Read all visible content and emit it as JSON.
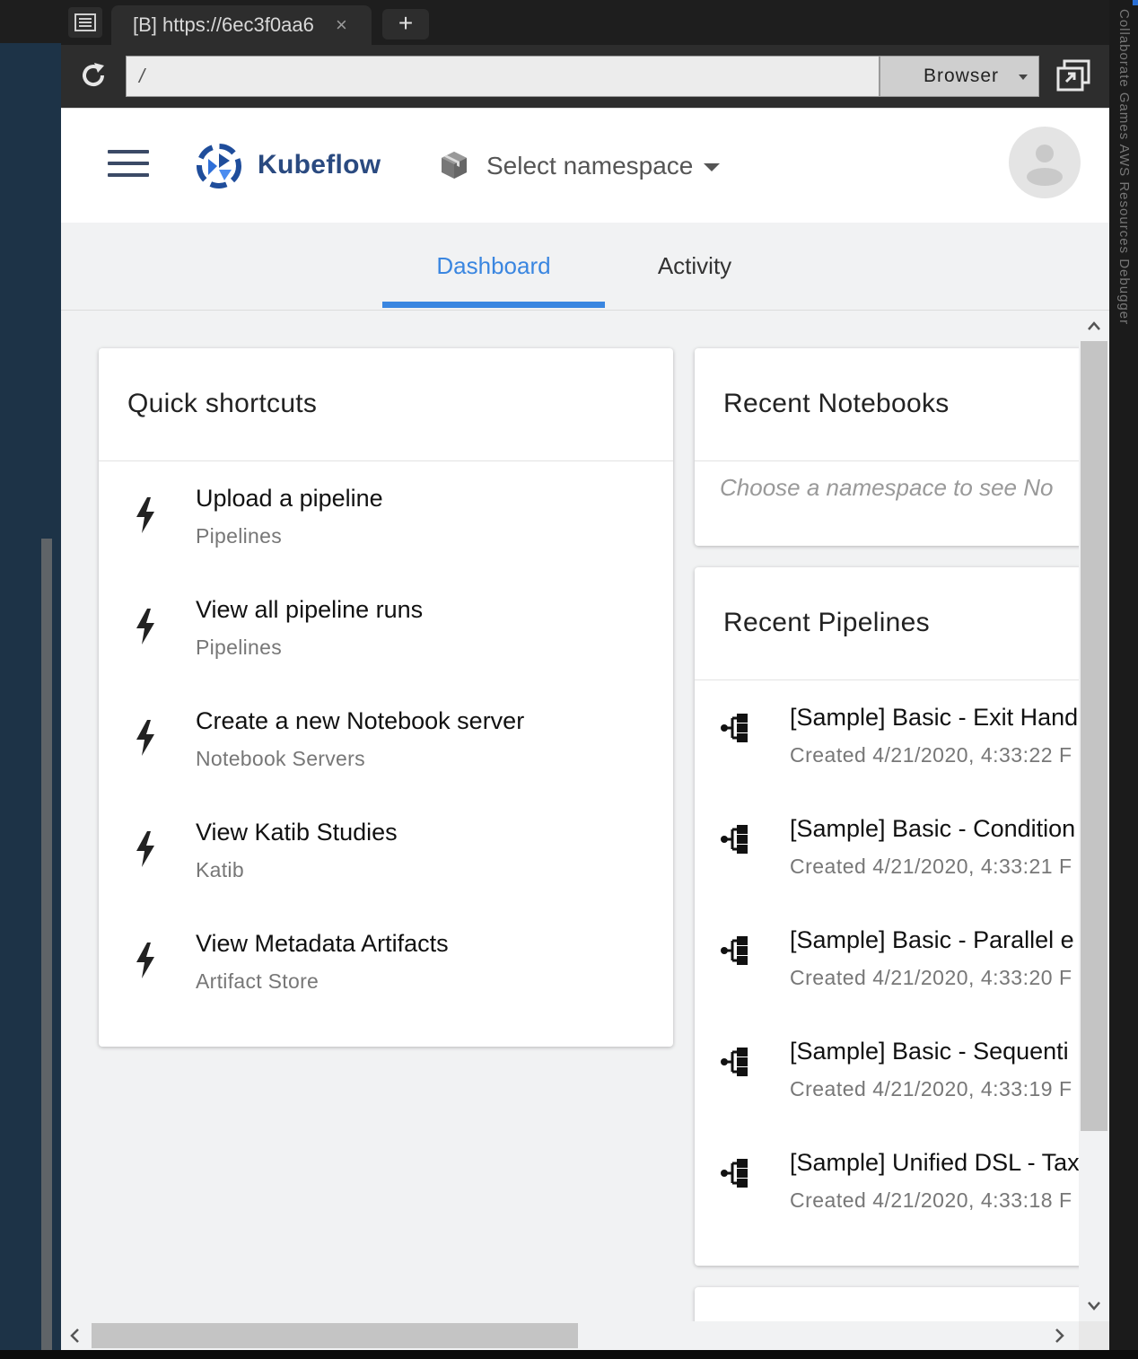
{
  "browser": {
    "tab_title": "[B] https://6ec3f0aa6",
    "tab_close": "×",
    "new_tab": "+",
    "url": "/",
    "browser_select": "Browser",
    "side_text": "Collaborate  Games  AWS Resources  Debugger"
  },
  "appbar": {
    "brand": "Kubeflow",
    "namespace_label": "Select namespace"
  },
  "tabs": [
    {
      "label": "Dashboard",
      "active": true
    },
    {
      "label": "Activity",
      "active": false
    }
  ],
  "quick_shortcuts": {
    "title": "Quick shortcuts",
    "items": [
      {
        "title": "Upload a pipeline",
        "subtitle": "Pipelines"
      },
      {
        "title": "View all pipeline runs",
        "subtitle": "Pipelines"
      },
      {
        "title": "Create a new Notebook server",
        "subtitle": "Notebook Servers"
      },
      {
        "title": "View Katib Studies",
        "subtitle": "Katib"
      },
      {
        "title": "View Metadata Artifacts",
        "subtitle": "Artifact Store"
      }
    ]
  },
  "recent_notebooks": {
    "title": "Recent Notebooks",
    "empty_text": "Choose a namespace to see No"
  },
  "recent_pipelines": {
    "title": "Recent Pipelines",
    "items": [
      {
        "title": "[Sample] Basic - Exit Hand",
        "created": "Created 4/21/2020, 4:33:22 F"
      },
      {
        "title": "[Sample] Basic - Condition",
        "created": "Created 4/21/2020, 4:33:21 F"
      },
      {
        "title": "[Sample] Basic - Parallel e",
        "created": "Created 4/21/2020, 4:33:20 F"
      },
      {
        "title": "[Sample] Basic - Sequenti",
        "created": "Created 4/21/2020, 4:33:19 F"
      },
      {
        "title": "[Sample] Unified DSL - Tax",
        "created": "Created 4/21/2020, 4:33:18 F"
      }
    ]
  },
  "colors": {
    "accent": "#3a86e0",
    "brand": "#2a4a80",
    "page_bg": "#f1f2f3"
  },
  "icons": {
    "menu": "hamburger-icon",
    "logo": "kubeflow-logo",
    "namespace": "cube-icon",
    "account": "account-avatar-icon",
    "shortcut": "bolt-icon",
    "pipeline": "pipeline-icon"
  }
}
